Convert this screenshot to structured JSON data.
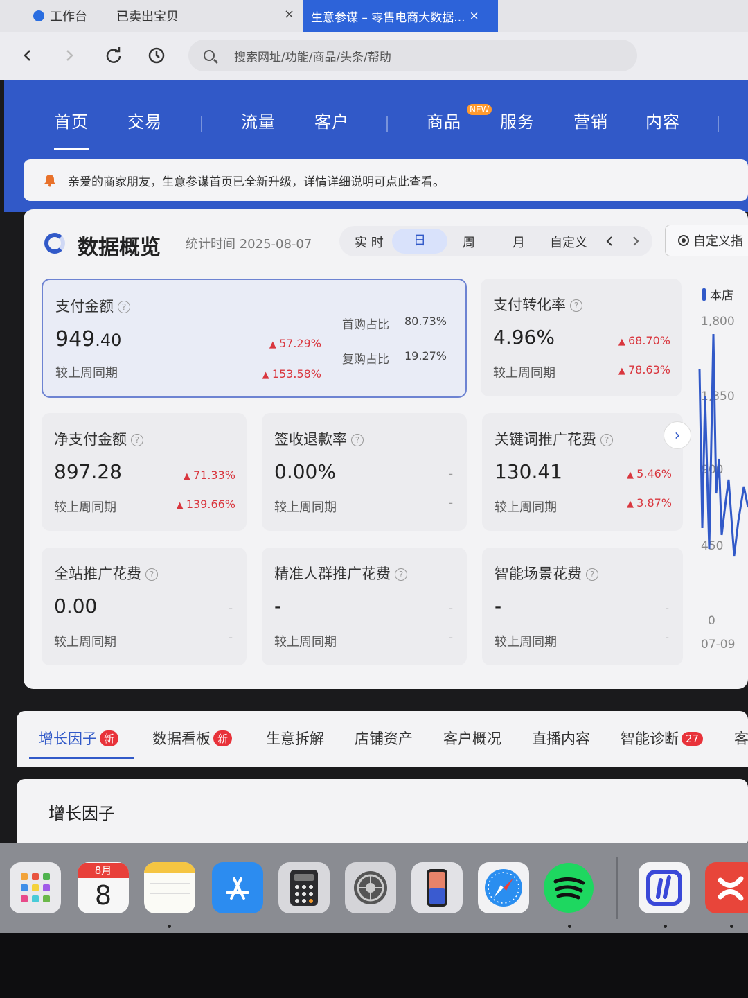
{
  "browser": {
    "tabs": [
      {
        "label": "工作台"
      },
      {
        "label": "已卖出宝贝"
      },
      {
        "label": "生意参谋 – 零售电商大数据...",
        "active": true
      }
    ],
    "close_glyph": "×",
    "address_placeholder": "搜索网址/功能/商品/头条/帮助"
  },
  "main_nav": {
    "items": [
      "首页",
      "交易",
      "流量",
      "客户",
      "商品",
      "服务",
      "营销",
      "内容"
    ],
    "new_badge": "NEW",
    "active": "首页"
  },
  "notice": {
    "text": "亲爱的商家朋友，生意参谋首页已全新升级，详情详细说明可点此查看。"
  },
  "overview": {
    "title": "数据概览",
    "stat_time": "统计时间 2025-08-07",
    "periods": [
      "实 时",
      "日",
      "周",
      "月",
      "自定义"
    ],
    "selected_period": "日",
    "custom_metric": "自定义指",
    "cards": [
      {
        "name": "支付金额",
        "value_int": "949",
        "value_dec": ".40",
        "delta1": "57.29%",
        "compare_label": "较上周同期",
        "delta2": "153.58%",
        "sub": [
          {
            "label": "首购占比",
            "value": "80.73%"
          },
          {
            "label": "复购占比",
            "value": "19.27%"
          }
        ]
      },
      {
        "name": "支付转化率",
        "value": "4.96%",
        "delta1": "68.70%",
        "compare_label": "较上周同期",
        "delta2": "78.63%"
      },
      {
        "name": "净支付金额",
        "value": "897.28",
        "delta1": "71.33%",
        "compare_label": "较上周同期",
        "delta2": "139.66%"
      },
      {
        "name": "签收退款率",
        "value": "0.00%",
        "delta1": "-",
        "compare_label": "较上周同期",
        "delta2": "-"
      },
      {
        "name": "关键词推广花费",
        "value": "130.41",
        "delta1": "5.46%",
        "compare_label": "较上周同期",
        "delta2": "3.87%"
      },
      {
        "name": "全站推广花费",
        "value": "0.00",
        "delta1": "-",
        "compare_label": "较上周同期",
        "delta2": "-"
      },
      {
        "name": "精准人群推广花费",
        "value": "-",
        "delta1": "-",
        "compare_label": "较上周同期",
        "delta2": "-"
      },
      {
        "name": "智能场景花费",
        "value": "-",
        "delta1": "-",
        "compare_label": "较上周同期",
        "delta2": "-"
      }
    ],
    "help_glyph": "?",
    "next_glyph": "›"
  },
  "side_chart": {
    "legend": "本店",
    "series_color": "#3159c8",
    "yticks": [
      "1,800",
      "1,350",
      "900",
      "450",
      "0"
    ],
    "x_first": "07-09"
  },
  "lower_tabs": {
    "items": [
      {
        "label": "增长因子",
        "badge": "新",
        "active": true
      },
      {
        "label": "数据看板",
        "badge": "新"
      },
      {
        "label": "生意拆解"
      },
      {
        "label": "店铺资产"
      },
      {
        "label": "客户概况"
      },
      {
        "label": "直播内容"
      },
      {
        "label": "智能诊断",
        "badge": "27"
      },
      {
        "label": "客"
      }
    ]
  },
  "growth_section": {
    "title": "增长因子"
  },
  "dock": {
    "calendar_month": "8月",
    "calendar_day": "8",
    "apps": [
      "launchpad-icon",
      "calendar-icon",
      "notes-icon",
      "app-store-icon",
      "calculator-icon",
      "system-settings-icon",
      "iphone-mirroring-icon",
      "safari-icon",
      "spotify-icon",
      "qianniu-icon",
      "app-icon"
    ]
  }
}
